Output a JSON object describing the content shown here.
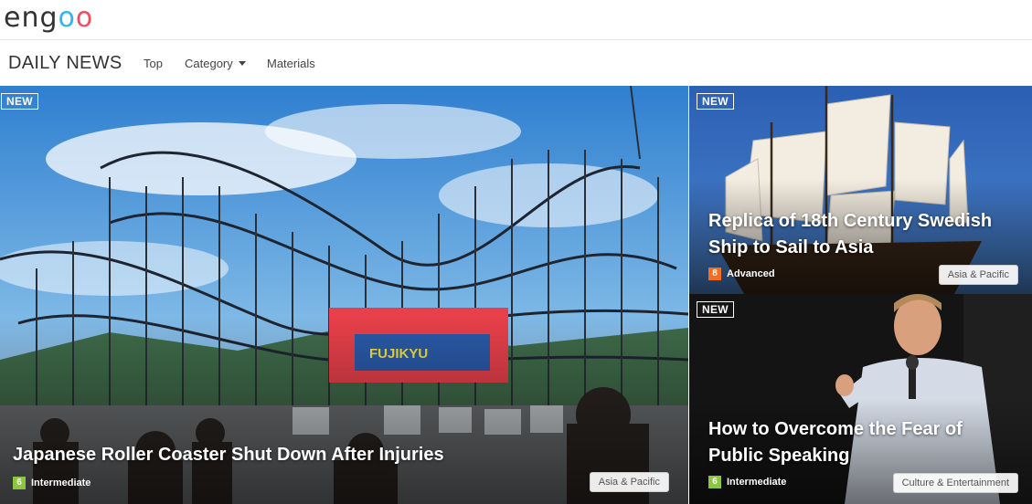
{
  "brand": {
    "logo_prefix": "eng",
    "logo_o1": "o",
    "logo_o2": "o"
  },
  "nav": {
    "title": "DAILY NEWS",
    "items": [
      {
        "label": "Top"
      },
      {
        "label": "Category"
      },
      {
        "label": "Materials"
      }
    ]
  },
  "articles": [
    {
      "badge": "NEW",
      "title": "Japanese Roller Coaster Shut Down After Injuries",
      "level_num": "6",
      "level_label": "Intermediate",
      "level_color": "#8cc63f",
      "category": "Asia & Pacific"
    },
    {
      "badge": "NEW",
      "title": "Replica of 18th Century Swedish Ship to Sail to Asia",
      "level_num": "8",
      "level_label": "Advanced",
      "level_color": "#f26f21",
      "category": "Asia & Pacific"
    },
    {
      "badge": "NEW",
      "title": "How to Overcome the Fear of Public Speaking",
      "level_num": "6",
      "level_label": "Intermediate",
      "level_color": "#8cc63f",
      "category": "Culture & Entertainment"
    }
  ],
  "images": {
    "main": "roller-coaster-photo",
    "ship": "tall-ship-photo",
    "speak": "speaker-photo"
  }
}
